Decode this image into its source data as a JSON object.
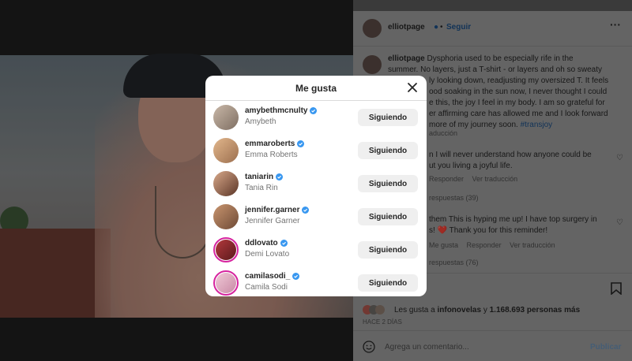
{
  "modal": {
    "title": "Me gusta",
    "users": [
      {
        "username": "amybethmcnulty",
        "full_name": "Amybeth",
        "button": "Siguiendo",
        "story_ring": false
      },
      {
        "username": "emmaroberts",
        "full_name": "Emma Roberts",
        "button": "Siguiendo",
        "story_ring": false
      },
      {
        "username": "taniarin",
        "full_name": "Tania Rin",
        "button": "Siguiendo",
        "story_ring": false
      },
      {
        "username": "jennifer.garner",
        "full_name": "Jennifer Garner",
        "button": "Siguiendo",
        "story_ring": false
      },
      {
        "username": "ddlovato",
        "full_name": "Demi Lovato",
        "button": "Siguiendo",
        "story_ring": true
      },
      {
        "username": "camilasodi_",
        "full_name": "Camila Sodi",
        "button": "Siguiendo",
        "story_ring": true
      }
    ]
  },
  "post": {
    "author": "elliotpage",
    "follow_label": "Seguir",
    "caption_lines": [
      "Dysphoria used to be especially rife in the",
      "summer. No layers, just a T-shirt - or layers and oh so sweaty",
      "ly looking down, readjusting my oversized T. It feels",
      "ood soaking in the sun now, I never thought I could",
      "e this, the joy I feel in my body. I am so grateful for",
      "er affirming care has allowed me and I look forward",
      "more of my journey soon."
    ],
    "hashtag": "#transjoy",
    "translate_partial": "aducción",
    "comment1_lines": [
      "n I will never understand how anyone could be",
      "ut you living a joyful life."
    ],
    "comment2_lines": [
      "them This is hyping me up! I have top surgery in",
      "s! ❤️ Thank you for this reminder!"
    ],
    "comment_actions": {
      "like": "Me gusta",
      "reply": "Responder",
      "translate": "Ver traducción"
    },
    "replies1": "respuestas (39)",
    "replies2": "respuestas (76)",
    "likes_text": "Les gusta a ",
    "likes_user": "infonovelas",
    "likes_and": " y ",
    "likes_count": "1.168.693 personas más",
    "time_ago": "HACE 2 DÍAS",
    "comment_placeholder": "Agrega un comentario...",
    "publish_label": "Publicar"
  },
  "colors": {
    "accent": "#0095f6",
    "verified": "#3897f0",
    "button_bg": "#efefef"
  }
}
